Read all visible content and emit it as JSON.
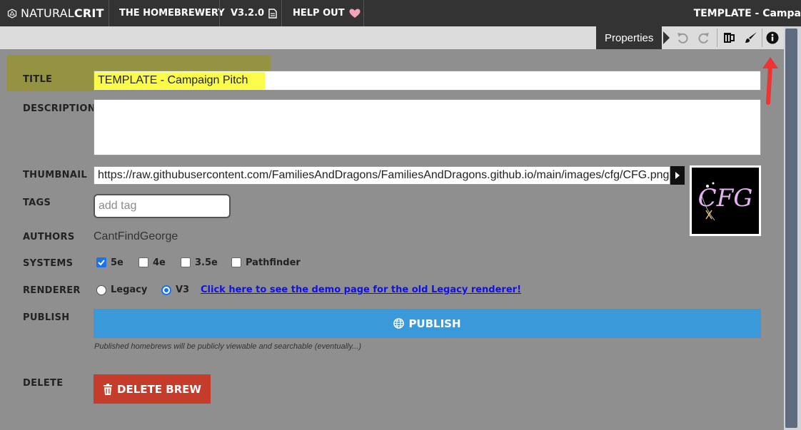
{
  "topnav": {
    "logo_natural": "NATURAL",
    "logo_crit": "CRIT",
    "homebrewery": "THE HOMEBREWERY",
    "version": "V3.2.0",
    "help_out": "HELP OUT",
    "doc_title": "TEMPLATE - Campa"
  },
  "toolbar": {
    "tooltip": "Properties",
    "icons": [
      "undo-icon",
      "redo-icon",
      "beer-mug-icon",
      "paint-brush-icon",
      "info-icon"
    ]
  },
  "form": {
    "title_label": "TITLE",
    "title_value": "TEMPLATE - Campaign Pitch",
    "description_label": "DESCRIPTION",
    "description_value": "",
    "thumbnail_label": "THUMBNAIL",
    "thumbnail_value": "https://raw.githubusercontent.com/FamiliesAndDragons/FamiliesAndDragons.github.io/main/images/cfg/CFG.png",
    "thumbnail_image_text": "CFG",
    "tags_label": "TAGS",
    "tags_placeholder": "add tag",
    "authors_label": "AUTHORS",
    "authors_value": "CantFindGeorge",
    "systems_label": "SYSTEMS",
    "systems": [
      {
        "label": "5e",
        "checked": true
      },
      {
        "label": "4e",
        "checked": false
      },
      {
        "label": "3.5e",
        "checked": false
      },
      {
        "label": "Pathfinder",
        "checked": false
      }
    ],
    "renderer_label": "RENDERER",
    "renderer_options": [
      {
        "label": "Legacy",
        "selected": false
      },
      {
        "label": "V3",
        "selected": true
      }
    ],
    "renderer_link": "Click here to see the demo page for the old Legacy renderer!",
    "publish_label": "PUBLISH",
    "publish_button": "PUBLISH",
    "publish_note": "Published homebrews will be publicly viewable and searchable (eventually...)",
    "delete_label": "DELETE",
    "delete_button": "DELETE BREW"
  },
  "colors": {
    "nav_bg": "#333333",
    "body_bg": "#8f8f8f",
    "title_highlight": "#fbfc4a",
    "publish_bg": "#3a9ad9",
    "delete_bg": "#c63c2b",
    "annotation_arrow": "#ee3333"
  }
}
